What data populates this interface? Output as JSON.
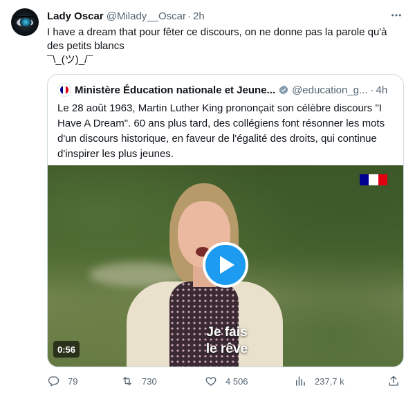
{
  "tweet": {
    "display_name": "Lady Oscar",
    "handle": "@Milady__Oscar",
    "separator": "·",
    "time": "2h",
    "more_icon": "more-horizontal-icon",
    "text_lines": [
      "I have a dream that pour fêter ce discours, on ne donne pas la parole qu'à",
      "des petits blancs",
      "¯\\_(ツ)_/¯"
    ]
  },
  "quote": {
    "display_name": "Ministère Éducation nationale et Jeune...",
    "handle": "@education_g...",
    "separator": "·",
    "time": "4h",
    "verified_icon": "verified-badge-icon",
    "text_lines": [
      "Le 28 août 1963, Martin Luther King prononçait son célèbre discours \"I",
      "Have A Dream\". 60 ans plus tard, des collégiens font résonner les mots",
      "d'un discours historique, en faveur de l'égalité des droits, qui continue",
      "d'inspirer les plus jeunes."
    ],
    "video": {
      "duration": "0:56",
      "subtitle_lines": [
        "Je fais",
        "le rêve"
      ],
      "play_icon": "play-icon"
    }
  },
  "actions": {
    "reply": {
      "icon": "reply-icon",
      "count": "79"
    },
    "retweet": {
      "icon": "retweet-icon",
      "count": "730"
    },
    "like": {
      "icon": "heart-icon",
      "count": "4 506"
    },
    "views": {
      "icon": "views-icon",
      "count": "237,7 k"
    },
    "share": {
      "icon": "share-icon"
    }
  },
  "colors": {
    "text": "#0f1419",
    "secondary": "#536471",
    "accent": "#1d9bf0",
    "border": "#cfd9de",
    "verified_gray": "#829aab",
    "flag_blue": "#000091",
    "flag_red": "#e1000f"
  }
}
